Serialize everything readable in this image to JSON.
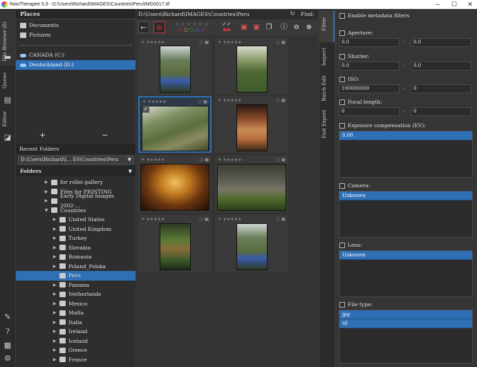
{
  "window": {
    "title": "RawTherapee 5.9 - D:\\Users\\Richard\\IMAGES\\Countries\\Peru\\IMG0017.tif",
    "minimize": "─",
    "maximize": "☐",
    "close": "✕"
  },
  "left_tabs": [
    "File Browser (8)",
    "Queue",
    "Editor"
  ],
  "places": {
    "header": "Places",
    "items": [
      "Documents",
      "Pictures"
    ],
    "drives": [
      "CANADA (C:)",
      "Deutschland (D:)"
    ],
    "add": "+",
    "remove": "−"
  },
  "recent": {
    "header": "Recent Folders",
    "value": "D:\\Users\\Richard\\I…  ES\\Countries\\Peru"
  },
  "folders": {
    "header": "Folders",
    "items": [
      "for rollei gallery",
      "Files for PRINTING",
      "Early Digital Images 2002-…",
      "Countries",
      "United States",
      "United Kingdom",
      "Turkey",
      "Slovakia",
      "Romania",
      "Poland_Polska",
      "Peru",
      "Panama",
      "Netherlands",
      "Mexico",
      "Malta",
      "Italia",
      "Ireland",
      "Iceland",
      "Greece",
      "France"
    ]
  },
  "path": {
    "value": "D:\\Users\\Richard\\IMAGES\\Countries\\Peru",
    "find_label": "Find:"
  },
  "right_tabs": [
    "Filter",
    "Inspect",
    "Batch Edit",
    "Fast Export"
  ],
  "filter": {
    "enable": "Enable metadata filters",
    "aperture": {
      "label": "Aperture:",
      "from": "0.0",
      "to": "0.0"
    },
    "shutter": {
      "label": "Shutter:",
      "from": "0.0",
      "to": "0.0"
    },
    "iso": {
      "label": "ISO:",
      "from": "100000000",
      "to": "0"
    },
    "focal": {
      "label": "Focal length:",
      "from": "0",
      "to": "0"
    },
    "exposure": {
      "label": "Exposure compensation (EV):",
      "value": "0.00"
    },
    "camera": {
      "label": "Camera:",
      "value": "Unknown"
    },
    "lens": {
      "label": "Lens:",
      "value": "Unknown"
    },
    "filetype": {
      "label": "File type:",
      "values": [
        "jpg",
        "tif"
      ]
    },
    "dash": "-"
  },
  "colors": {
    "accent": "#2f6fb5"
  }
}
